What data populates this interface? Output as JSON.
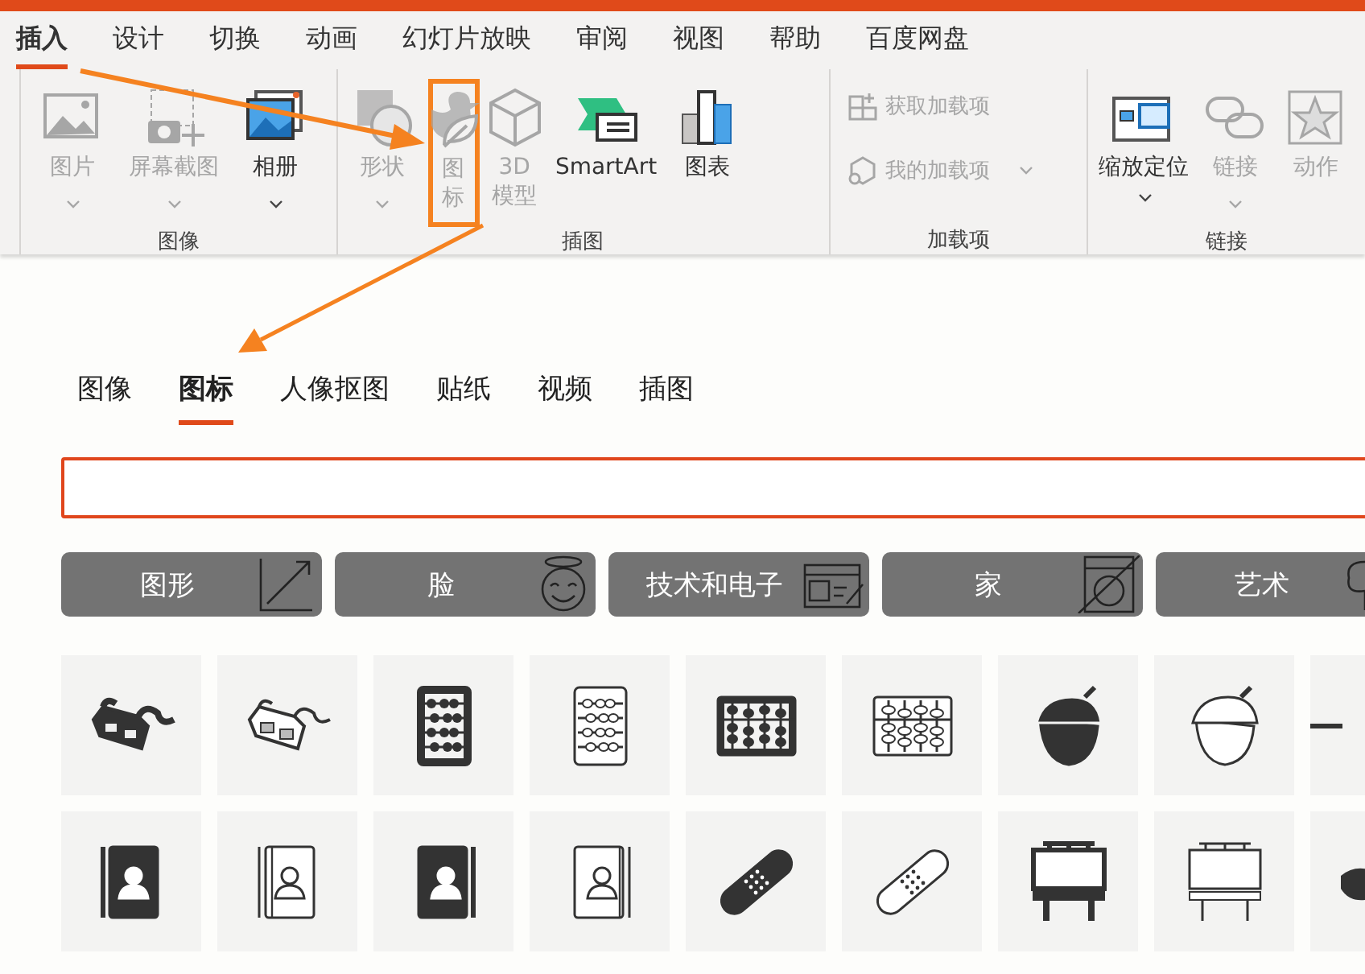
{
  "ribbon": {
    "tabs": [
      {
        "label": "插入",
        "selected": true
      },
      {
        "label": "设计",
        "selected": false
      },
      {
        "label": "切换",
        "selected": false
      },
      {
        "label": "动画",
        "selected": false
      },
      {
        "label": "幻灯片放映",
        "selected": false
      },
      {
        "label": "审阅",
        "selected": false
      },
      {
        "label": "视图",
        "selected": false
      },
      {
        "label": "帮助",
        "selected": false
      },
      {
        "label": "百度网盘",
        "selected": false
      }
    ],
    "groups": [
      {
        "label": "图像",
        "commands": [
          {
            "kind": "large",
            "label": "图片",
            "disabled": true,
            "dropdown": true,
            "highlighted": false
          },
          {
            "kind": "large",
            "label": "屏幕截图",
            "disabled": true,
            "dropdown": true,
            "highlighted": false
          },
          {
            "kind": "large",
            "label": "相册",
            "disabled": false,
            "dropdown": true,
            "highlighted": false
          }
        ]
      },
      {
        "label": "插图",
        "commands": [
          {
            "kind": "large",
            "label": "形状",
            "disabled": true,
            "dropdown": true,
            "highlighted": false
          },
          {
            "kind": "large",
            "label": "图标",
            "disabled": true,
            "dropdown": false,
            "highlighted": true
          },
          {
            "kind": "large",
            "label": "3D模型",
            "disabled": true,
            "dropdown": false,
            "highlighted": false
          },
          {
            "kind": "large",
            "label": "SmartArt",
            "disabled": false,
            "dropdown": false,
            "highlighted": false
          },
          {
            "kind": "large",
            "label": "图表",
            "disabled": false,
            "dropdown": false,
            "highlighted": false
          }
        ]
      },
      {
        "label": "加载项",
        "commands": [
          {
            "kind": "small",
            "label": "获取加载项",
            "disabled": true,
            "dropdown": false,
            "highlighted": false
          },
          {
            "kind": "small",
            "label": "我的加载项",
            "disabled": true,
            "dropdown": true,
            "highlighted": false
          }
        ]
      },
      {
        "label": "链接",
        "commands": [
          {
            "kind": "large",
            "label": "缩放定位",
            "disabled": false,
            "dropdown": true,
            "highlighted": false
          },
          {
            "kind": "large",
            "label": "链接",
            "disabled": true,
            "dropdown": true,
            "highlighted": false
          },
          {
            "kind": "large",
            "label": "动作",
            "disabled": true,
            "dropdown": false,
            "highlighted": false
          }
        ]
      }
    ]
  },
  "dialog": {
    "tabs": [
      {
        "label": "图像",
        "selected": false
      },
      {
        "label": "图标",
        "selected": true
      },
      {
        "label": "人像抠图",
        "selected": false
      },
      {
        "label": "贴纸",
        "selected": false
      },
      {
        "label": "视频",
        "selected": false
      },
      {
        "label": "插图",
        "selected": false
      }
    ],
    "categories": [
      {
        "label": "图形"
      },
      {
        "label": "脸"
      },
      {
        "label": "技术和电子"
      },
      {
        "label": "家"
      },
      {
        "label": "艺术"
      }
    ]
  }
}
